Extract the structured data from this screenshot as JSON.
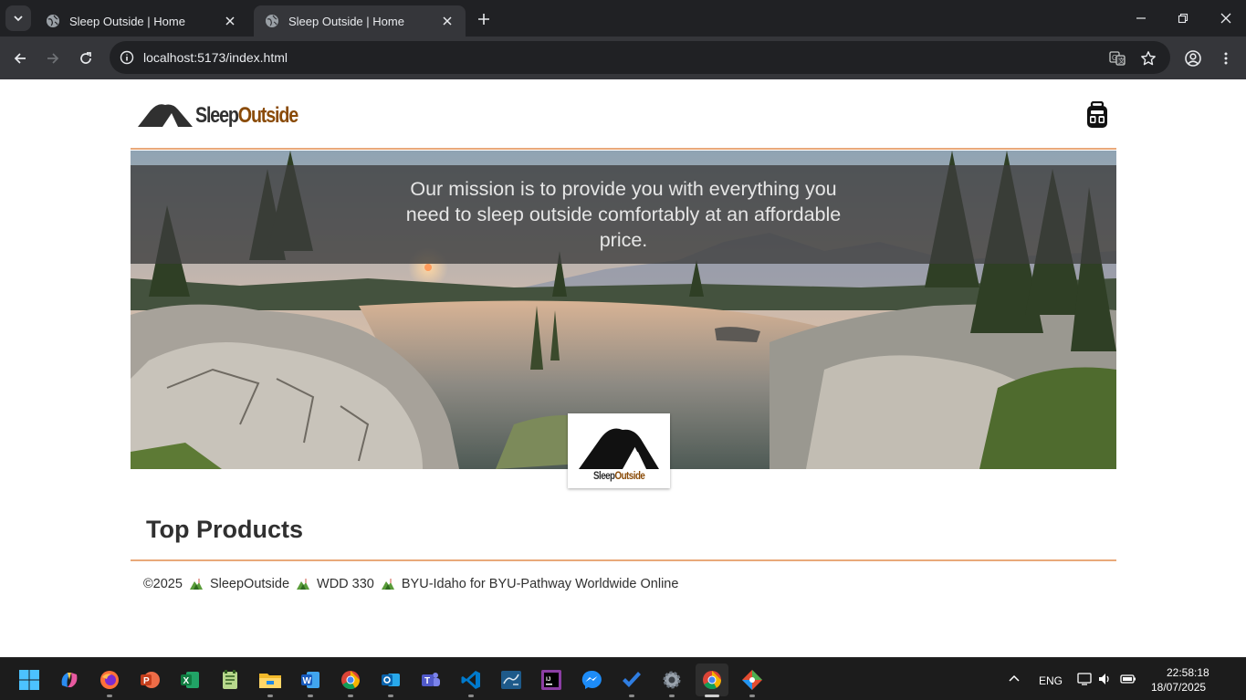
{
  "browser": {
    "tabs": [
      {
        "title": "Sleep Outside | Home",
        "active": false
      },
      {
        "title": "Sleep Outside | Home",
        "active": true
      }
    ],
    "url": "localhost:5173/index.html"
  },
  "site": {
    "logo": {
      "part1": "Sleep",
      "part2": "Outside"
    },
    "hero": {
      "mission": "Our mission is to provide you with everything you need to sleep outside comfortably at an affordable price.",
      "badge": {
        "part1": "Sleep",
        "part2": "Outside"
      }
    },
    "top_products_title": "Top Products",
    "footer": {
      "copyright": "©2025",
      "brand": "SleepOutside",
      "course": "WDD 330",
      "school": "BYU-Idaho for BYU-Pathway Worldwide Online"
    },
    "colors": {
      "accent": "#e9a97a",
      "brand_brown": "#8a4b08",
      "text": "#303030"
    }
  },
  "taskbar": {
    "apps": [
      "start-icon",
      "copilot-icon",
      "firefox-icon",
      "powerpoint-icon",
      "excel-icon",
      "notepad-icon",
      "file-explorer-icon",
      "word-icon",
      "chrome-icon",
      "outlook-icon",
      "teams-icon",
      "vscode-icon",
      "mysql-workbench-icon",
      "intellij-icon",
      "messenger-icon",
      "todo-icon",
      "settings-icon",
      "chrome-active-icon",
      "git-icon"
    ],
    "language": "ENG",
    "time": "22:58:18",
    "date": "18/07/2025"
  }
}
